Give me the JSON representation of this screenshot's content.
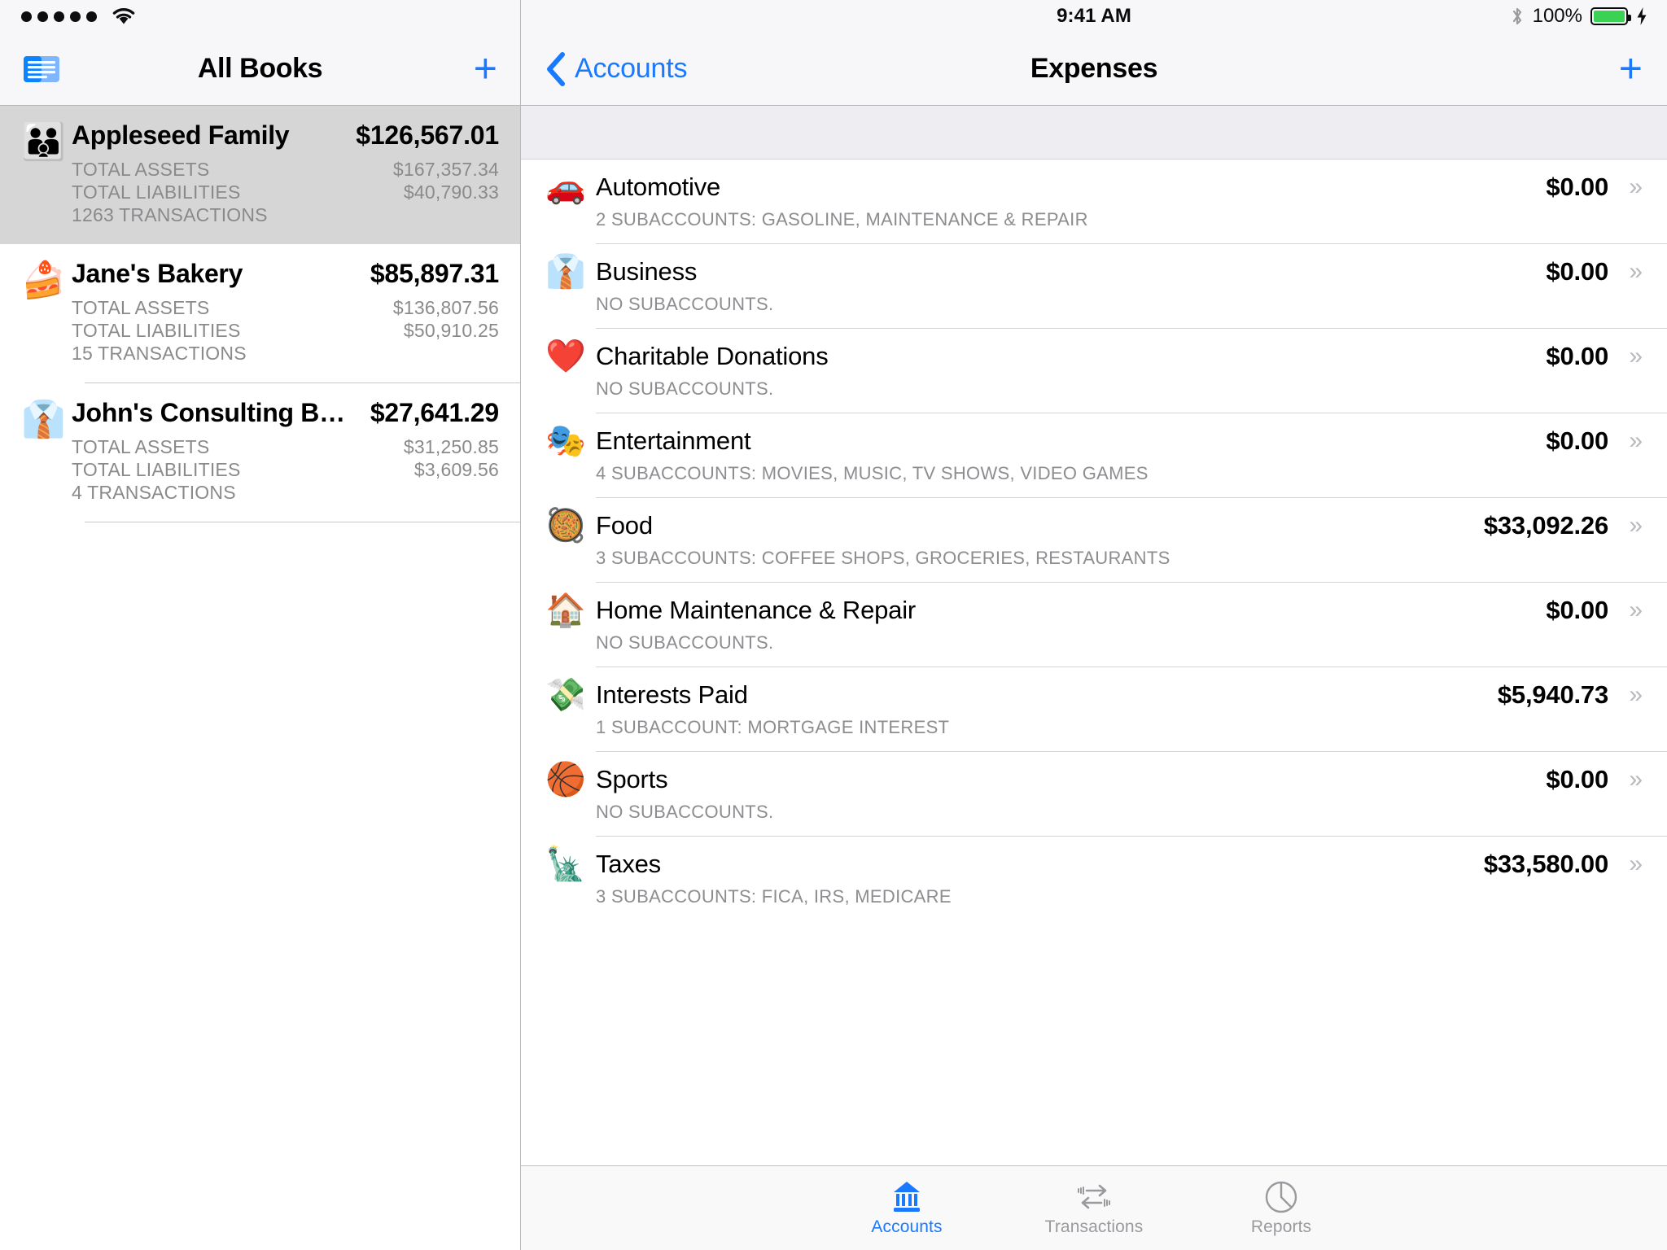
{
  "status_bar": {
    "signal_dots": 5,
    "wifi_icon": "wifi-icon",
    "time": "9:41 AM",
    "bluetooth_icon": "bluetooth-icon",
    "battery_percent": "100%",
    "battery_level": 100,
    "charging_icon": "lightning-bolt-icon",
    "battery_color": "#3ad154"
  },
  "sidebar": {
    "nav": {
      "books_icon": "books-list-icon",
      "title": "All Books",
      "add_label": "+"
    },
    "books": [
      {
        "emoji": "👪",
        "emoji_name": "family-emoji",
        "name": "Appleseed Family",
        "balance": "$126,567.01",
        "assets_label": "TOTAL ASSETS",
        "assets_value": "$167,357.34",
        "liabilities_label": "TOTAL LIABILITIES",
        "liabilities_value": "$40,790.33",
        "transactions": "1263 TRANSACTIONS",
        "selected": true
      },
      {
        "emoji": "🍰",
        "emoji_name": "cake-slice-emoji",
        "name": "Jane's Bakery",
        "balance": "$85,897.31",
        "assets_label": "TOTAL ASSETS",
        "assets_value": "$136,807.56",
        "liabilities_label": "TOTAL LIABILITIES",
        "liabilities_value": "$50,910.25",
        "transactions": "15 TRANSACTIONS",
        "selected": false
      },
      {
        "emoji": "👔",
        "emoji_name": "necktie-emoji",
        "name": "John's Consulting B…",
        "balance": "$27,641.29",
        "assets_label": "TOTAL ASSETS",
        "assets_value": "$31,250.85",
        "liabilities_label": "TOTAL LIABILITIES",
        "liabilities_value": "$3,609.56",
        "transactions": "4 TRANSACTIONS",
        "selected": false
      }
    ]
  },
  "detail": {
    "nav": {
      "back_icon": "chevron-left-icon",
      "back_label": "Accounts",
      "title": "Expenses",
      "add_label": "+"
    },
    "categories": [
      {
        "emoji": "🚗",
        "emoji_name": "car-emoji",
        "name": "Automotive",
        "amount": "$0.00",
        "subaccounts": "2 SUBACCOUNTS: GASOLINE, MAINTENANCE & REPAIR",
        "chevron": "»"
      },
      {
        "emoji": "👔",
        "emoji_name": "necktie-emoji",
        "name": "Business",
        "amount": "$0.00",
        "subaccounts": "NO SUBACCOUNTS.",
        "chevron": "»"
      },
      {
        "emoji": "❤️",
        "emoji_name": "red-heart-emoji",
        "name": "Charitable Donations",
        "amount": "$0.00",
        "subaccounts": "NO SUBACCOUNTS.",
        "chevron": "»"
      },
      {
        "emoji": "🎭",
        "emoji_name": "performing-arts-emoji",
        "name": "Entertainment",
        "amount": "$0.00",
        "subaccounts": "4 SUBACCOUNTS: MOVIES, MUSIC, TV SHOWS, VIDEO GAMES",
        "chevron": "»"
      },
      {
        "emoji": "🥘",
        "emoji_name": "shallow-pan-of-food-emoji",
        "name": "Food",
        "amount": "$33,092.26",
        "subaccounts": "3 SUBACCOUNTS: COFFEE SHOPS, GROCERIES, RESTAURANTS",
        "chevron": "»"
      },
      {
        "emoji": "🏠",
        "emoji_name": "house-emoji",
        "name": "Home Maintenance & Repair",
        "amount": "$0.00",
        "subaccounts": "NO SUBACCOUNTS.",
        "chevron": "»"
      },
      {
        "emoji": "💸",
        "emoji_name": "money-with-wings-emoji",
        "name": "Interests Paid",
        "amount": "$5,940.73",
        "subaccounts": "1 SUBACCOUNT: MORTGAGE INTEREST",
        "chevron": "»"
      },
      {
        "emoji": "🏀",
        "emoji_name": "basketball-emoji",
        "name": "Sports",
        "amount": "$0.00",
        "subaccounts": "NO SUBACCOUNTS.",
        "chevron": "»"
      },
      {
        "emoji": "🗽",
        "emoji_name": "statue-of-liberty-emoji",
        "name": "Taxes",
        "amount": "$33,580.00",
        "subaccounts": "3 SUBACCOUNTS: FICA, IRS, MEDICARE",
        "chevron": "»"
      }
    ]
  },
  "tabbar": {
    "active": "Accounts",
    "accent_color": "#1a7aff",
    "inactive_color": "#9a9a9e",
    "tabs": [
      {
        "label": "Accounts",
        "icon": "bank-icon",
        "active": true
      },
      {
        "label": "Transactions",
        "icon": "transfer-arrows-icon",
        "active": false
      },
      {
        "label": "Reports",
        "icon": "pie-chart-icon",
        "active": false
      }
    ]
  }
}
